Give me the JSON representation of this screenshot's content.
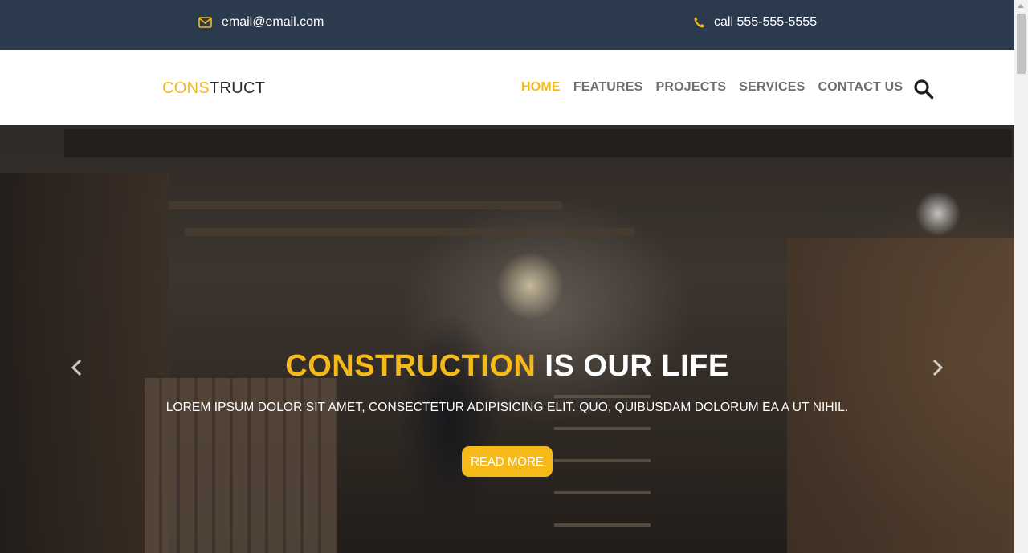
{
  "topbar": {
    "email": "email@email.com",
    "phone": "call 555-555-5555",
    "email_icon": "envelope-icon",
    "phone_icon": "phone-icon"
  },
  "header": {
    "logo_part1": "CONS",
    "logo_part2": "TRUCT",
    "nav": [
      {
        "label": "HOME",
        "active": true
      },
      {
        "label": "FEATURES",
        "active": false
      },
      {
        "label": "PROJECTS",
        "active": false
      },
      {
        "label": "SERVICES",
        "active": false
      },
      {
        "label": "CONTACT US",
        "active": false
      }
    ],
    "search_icon": "search-icon"
  },
  "hero": {
    "headline_highlight": "CONSTRUCTION",
    "headline_rest": " IS OUR LIFE",
    "subline": "LOREM IPSUM DOLOR SIT AMET, CONSECTETUR ADIPISICING ELIT. QUO, QUIBUSDAM DOLORUM EA A UT NIHIL.",
    "button": "READ MORE",
    "prev_icon": "chevron-left-icon",
    "next_icon": "chevron-right-icon"
  },
  "colors": {
    "accent": "#f6b91a",
    "topbar_bg": "#2c3a4e",
    "nav_text": "#6e6e6e"
  }
}
